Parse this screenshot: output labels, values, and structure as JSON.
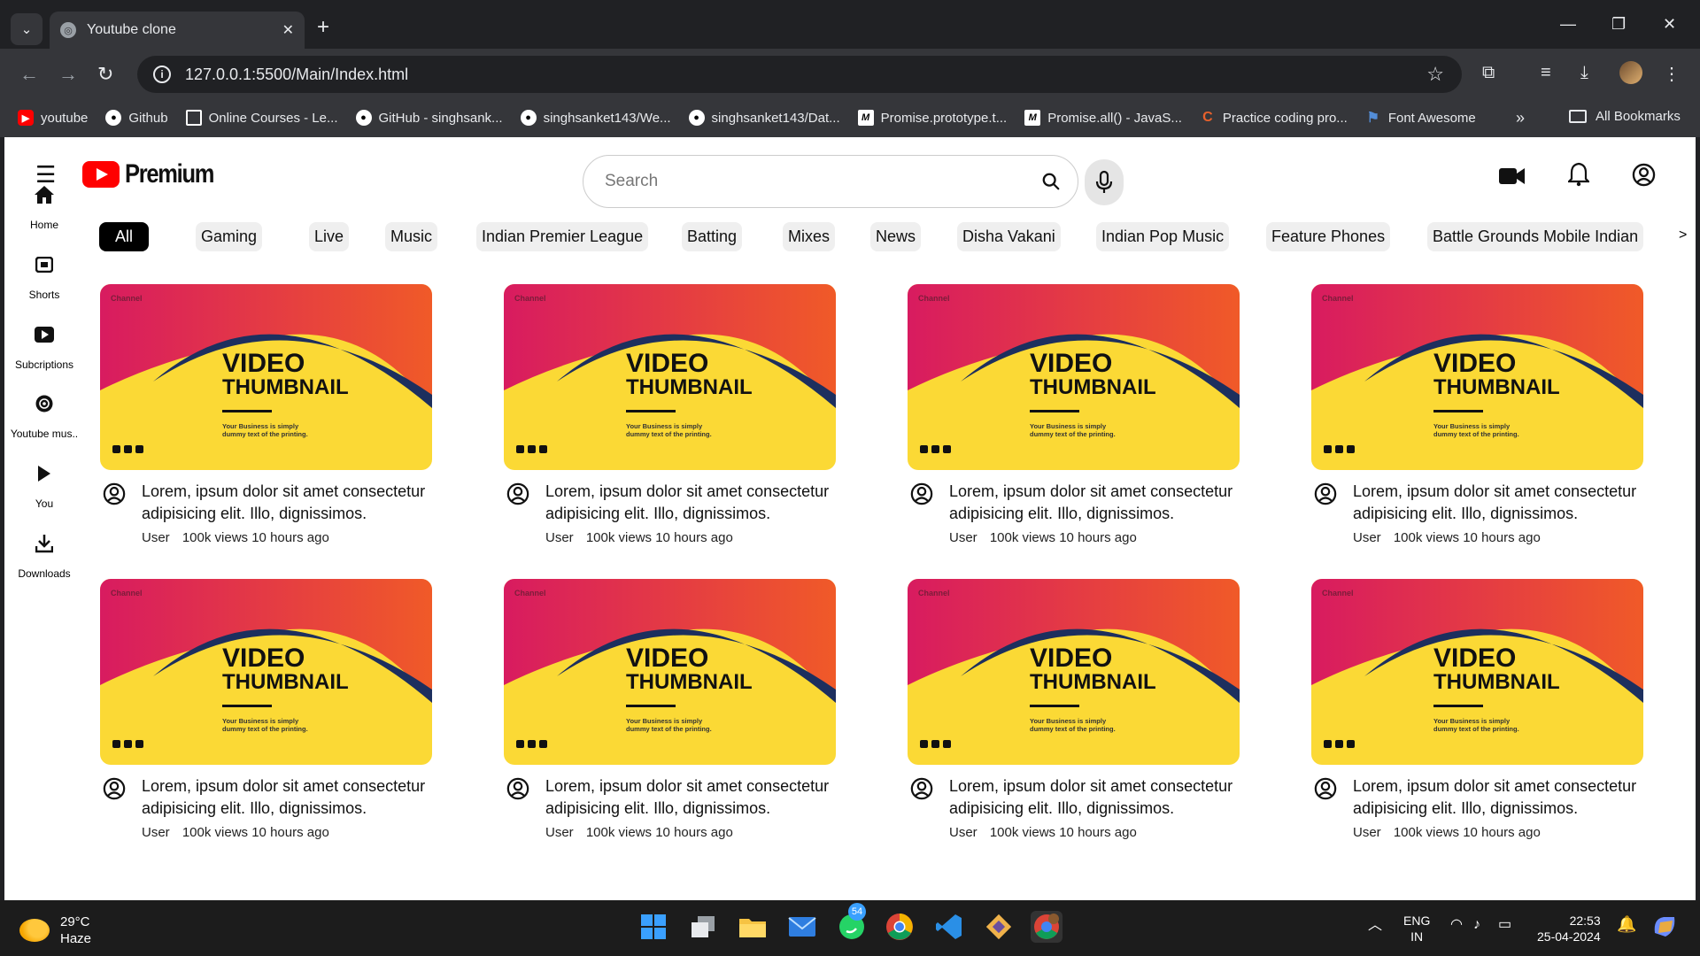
{
  "browser": {
    "tab_title": "Youtube clone",
    "url": "127.0.0.1:5500/Main/Index.html",
    "bookmarks": [
      {
        "label": "youtube",
        "color": "#ff0000"
      },
      {
        "label": "Github",
        "color": "#ffffff"
      },
      {
        "label": "Online Courses - Le...",
        "color": "#ffffff"
      },
      {
        "label": "GitHub - singhsank...",
        "color": "#ffffff"
      },
      {
        "label": "singhsanket143/We...",
        "color": "#ffffff"
      },
      {
        "label": "singhsanket143/Dat...",
        "color": "#ffffff"
      },
      {
        "label": "Promise.prototype.t...",
        "color": "#ffffff"
      },
      {
        "label": "Promise.all() - JavaS...",
        "color": "#ffffff"
      },
      {
        "label": "Practice coding pro...",
        "color": "#e8612c"
      },
      {
        "label": "Font Awesome",
        "color": "#538dd7"
      }
    ],
    "all_bookmarks": "All Bookmarks"
  },
  "header": {
    "logo_text": "Premium",
    "search_placeholder": "Search"
  },
  "sidebar": {
    "items": [
      {
        "label": "Home",
        "icon": "home-icon"
      },
      {
        "label": "Shorts",
        "icon": "shorts-icon"
      },
      {
        "label": "Subcriptions",
        "icon": "subscriptions-icon"
      },
      {
        "label": "Youtube mus..",
        "icon": "youtube-music-icon"
      },
      {
        "label": "You",
        "icon": "you-icon"
      },
      {
        "label": "Downloads",
        "icon": "download-icon"
      }
    ]
  },
  "chips": [
    "All",
    "Gaming",
    "Live",
    "Music",
    "Indian Premier League",
    "Batting",
    "Mixes",
    "News",
    "Disha Vakani",
    "Indian Pop Music",
    "Feature Phones",
    "Battle Grounds Mobile Indian"
  ],
  "chip_arrow": ">",
  "videos": [
    {
      "title": "Lorem, ipsum dolor sit amet consectetur adipisicing elit. Illo, dignissimos.",
      "channel": "User",
      "stats": "100k views 10 hours ago"
    },
    {
      "title": "Lorem, ipsum dolor sit amet consectetur adipisicing elit. Illo, dignissimos.",
      "channel": "User",
      "stats": "100k views 10 hours ago"
    },
    {
      "title": "Lorem, ipsum dolor sit amet consectetur adipisicing elit. Illo, dignissimos.",
      "channel": "User",
      "stats": "100k views 10 hours ago"
    },
    {
      "title": "Lorem, ipsum dolor sit amet consectetur adipisicing elit. Illo, dignissimos.",
      "channel": "User",
      "stats": "100k views 10 hours ago"
    },
    {
      "title": "Lorem, ipsum dolor sit amet consectetur adipisicing elit. Illo, dignissimos.",
      "channel": "User",
      "stats": "100k views 10 hours ago"
    },
    {
      "title": "Lorem, ipsum dolor sit amet consectetur adipisicing elit. Illo, dignissimos.",
      "channel": "User",
      "stats": "100k views 10 hours ago"
    },
    {
      "title": "Lorem, ipsum dolor sit amet consectetur adipisicing elit. Illo, dignissimos.",
      "channel": "User",
      "stats": "100k views 10 hours ago"
    },
    {
      "title": "Lorem, ipsum dolor sit amet consectetur adipisicing elit. Illo, dignissimos.",
      "channel": "User",
      "stats": "100k views 10 hours ago"
    }
  ],
  "thumbnail": {
    "brand": "Channel",
    "line1": "VIDEO",
    "line2": "THUMBNAIL",
    "tagline1": "Your Business is simply",
    "tagline2": "dummy text of the printing.",
    "colors": {
      "gradient_start": "#d81b60",
      "gradient_end": "#f05a28",
      "yellow": "#fbd935",
      "navy": "#1d2f5e"
    }
  },
  "taskbar": {
    "temp": "29°C",
    "condition": "Haze",
    "whatsapp_badge": "54",
    "lang1": "ENG",
    "lang2": "IN",
    "time": "22:53",
    "date": "25-04-2024"
  }
}
